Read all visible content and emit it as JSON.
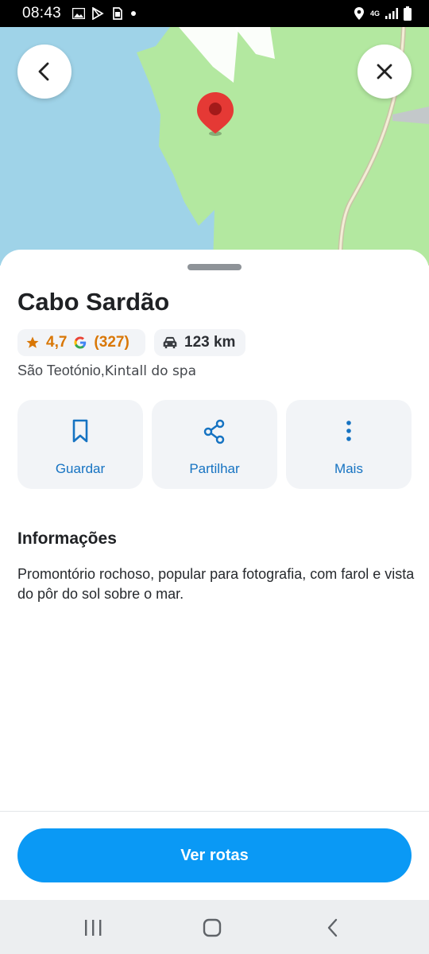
{
  "status_bar": {
    "time": "08:43",
    "network": "4G"
  },
  "map": {
    "water_color": "#9fd3e8",
    "land_color": "#b3e8a0",
    "pin_color": "#e53935"
  },
  "place": {
    "title": "Cabo Sardão",
    "rating": "4,7",
    "review_count": "(327)",
    "distance": "123 km",
    "address_main": "São Teotónio,",
    "address_extra": "Kintall do spa"
  },
  "actions": [
    {
      "label": "Guardar",
      "icon": "bookmark-icon"
    },
    {
      "label": "Partilhar",
      "icon": "share-icon"
    },
    {
      "label": "Mais",
      "icon": "more-vertical-icon"
    }
  ],
  "info": {
    "title": "Informações",
    "description": "Promontório rochoso, popular para fotografia, com farol e vista do pôr do sol sobre o mar."
  },
  "cta": {
    "label": "Ver rotas",
    "color": "#0a99f5"
  },
  "accent_color": "#1673c2"
}
